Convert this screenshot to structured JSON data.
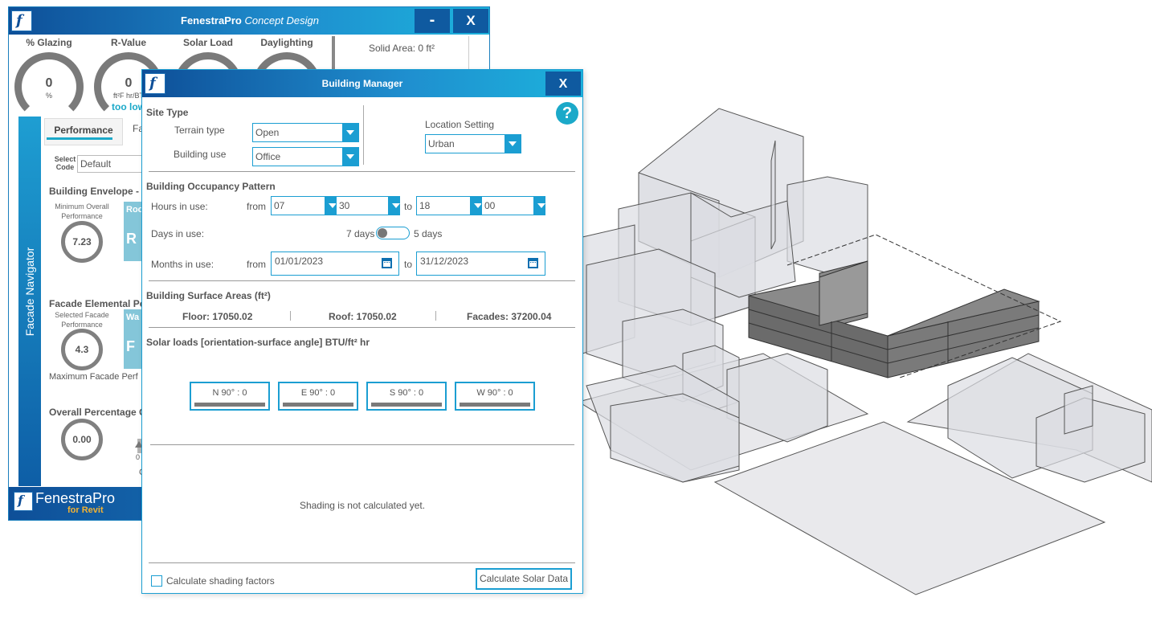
{
  "concept_window": {
    "title_brand": "FenestraPro",
    "title_product": "Concept Design",
    "minimize_label": "-",
    "close_label": "X",
    "gauges": [
      {
        "label": "% Glazing",
        "value": "0",
        "unit": "%"
      },
      {
        "label": "R-Value",
        "value": "0",
        "unit": "ft²F hr/BT"
      },
      {
        "label": "Solar Load",
        "value": "",
        "unit": ""
      },
      {
        "label": "Daylighting",
        "value": "",
        "unit": ""
      }
    ],
    "rvalue_status": "too low",
    "solid_area": "Solid Area: 0 ft²",
    "nav_label": "Facade Navigator",
    "tab_performance": "Performance",
    "tab_fa": "Fa",
    "select_code_label": "Select Code",
    "code_value": "Default",
    "envelope_title": "Building Envelope - ",
    "min_overall_label": "Minimum Overall Performance",
    "min_overall_value": "7.23",
    "card1_title": "Roo",
    "card1_letter": "R",
    "facade_elemental_title": "Facade Elemental Pe",
    "selected_facade_label": "Selected Facade Performance",
    "selected_facade_value": "4.3",
    "card2_title": "Wa",
    "card2_letter": "F",
    "max_facade_label": "Maximum Facade Perf",
    "overall_pct_title": "Overall Percentage G",
    "overall_pct_value": "0.00",
    "slider_zero": "0",
    "cu_label": "Cu",
    "footer_brand": "FenestraPro",
    "footer_sub": "for Revit",
    "logo_glyph": "f"
  },
  "building_manager": {
    "title": "Building Manager",
    "close_label": "X",
    "help_label": "?",
    "site_type": {
      "title": "Site Type",
      "terrain_label": "Terrain type",
      "terrain_value": "Open",
      "use_label": "Building use",
      "use_value": "Office",
      "location_label": "Location Setting",
      "location_value": "Urban"
    },
    "occupancy": {
      "title": "Building Occupancy Pattern",
      "hours_label": "Hours in use:",
      "from_label": "from",
      "to_label": "to",
      "from_hour": "07",
      "from_min": "30",
      "to_hour": "18",
      "to_min": "00",
      "days_label": "Days in use:",
      "days_left": "7 days",
      "days_right": "5 days",
      "months_label": "Months in use:",
      "from_date": "01/01/2023",
      "to_date": "31/12/2023"
    },
    "areas": {
      "title": "Building Surface Areas (ft²)",
      "floor": "Floor: 17050.02",
      "roof": "Roof: 17050.02",
      "facades": "Facades: 37200.04"
    },
    "solar": {
      "title": "Solar loads [orientation-surface angle] BTU/ft² hr",
      "buttons": [
        "N 90° : 0",
        "E 90° : 0",
        "S 90° : 0",
        "W 90° : 0"
      ]
    },
    "shading_message": "Shading is not calculated yet.",
    "calc_shading_label": "Calculate shading factors",
    "calc_solar_label": "Calculate Solar Data"
  },
  "colors": {
    "accent": "#1b9ed2",
    "title_dark": "#0e4f98",
    "teal": "#1ba9c9",
    "gauge_grey": "#7a7a7a",
    "building_dark": "#6b6b6b"
  }
}
